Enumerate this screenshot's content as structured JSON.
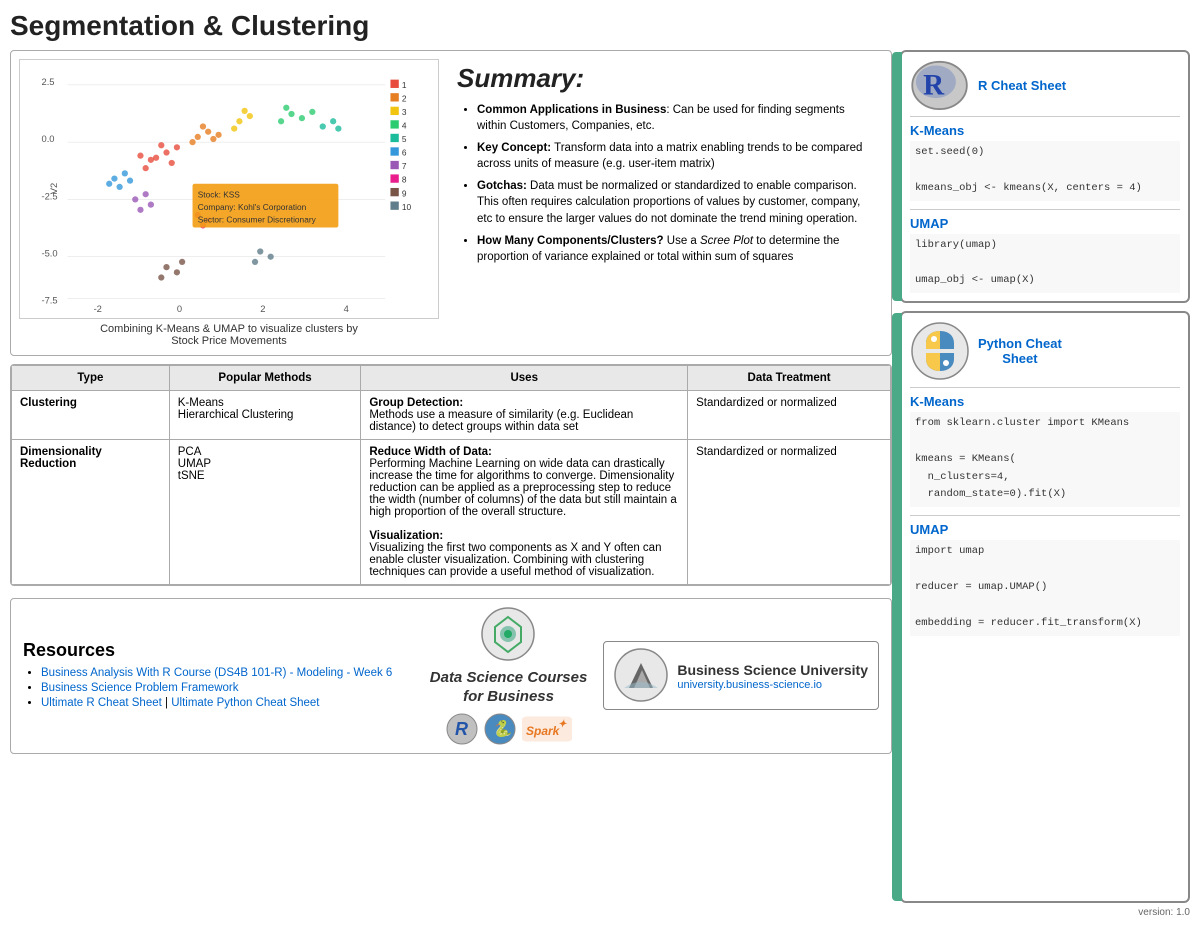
{
  "page": {
    "title": "Segmentation & Clustering",
    "version": "version: 1.0"
  },
  "chart": {
    "caption": "Combining K-Means & UMAP to visualize clusters by\nStock Price Movements",
    "tooltip": {
      "stock": "Stock: KSS",
      "company": "Company: Kohl's Corporation",
      "sector": "Sector: Consumer Discretionary"
    },
    "legend": [
      "1",
      "2",
      "3",
      "4",
      "5",
      "6",
      "7",
      "8",
      "9",
      "10"
    ]
  },
  "summary": {
    "title": "Summary:",
    "bullets": [
      {
        "bold": "Common Applications in Business",
        "text": ": Can be used for finding segments within Customers, Companies, etc."
      },
      {
        "bold": "Key Concept:",
        "text": " Transform data into a matrix enabling trends to be compared across units of measure (e.g. user-item matrix)"
      },
      {
        "bold": "Gotchas:",
        "text": " Data must be normalized or standardized to enable comparison. This often requires calculation proportions of values by customer, company, etc to ensure the larger values do not dominate the trend mining operation."
      },
      {
        "bold": "How Many Components/Clusters?",
        "text": " Use a Scree Plot to determine the proportion of variance explained or total within sum of squares",
        "italic": "Scree Plot"
      }
    ]
  },
  "table": {
    "headers": [
      "Type",
      "Popular Methods",
      "Uses",
      "Data Treatment"
    ],
    "rows": [
      {
        "type": "Clustering",
        "methods": "K-Means\nHierarchical Clustering",
        "uses_title": "Group Detection:",
        "uses_body": "Methods use a measure of similarity (e.g. Euclidean distance) to detect groups within data set",
        "treatment": "Standardized or normalized"
      },
      {
        "type": "Dimensionality Reduction",
        "methods": "PCA\nUMAP\ntSNE",
        "uses_title1": "Reduce Width of Data:",
        "uses_body1": "Performing Machine Learning on wide data can drastically increase the time for algorithms to converge. Dimensionality reduction can be applied as a preprocessing step to reduce the width (number of columns) of the data but still maintain a high proportion of the overall structure.",
        "uses_title2": "Visualization:",
        "uses_body2": "Visualizing the first two components as X and Y often can enable cluster visualization. Combining with clustering techniques can provide a useful method of visualization.",
        "treatment": "Standardized or normalized"
      }
    ]
  },
  "r_cheat": {
    "link_text": "R Cheat Sheet",
    "kmeans_title": "K-Means",
    "kmeans_code": [
      "set.seed(0)",
      "kmeans_obj <- kmeans(X, centers = 4)"
    ],
    "umap_title": "UMAP",
    "umap_code": [
      "library(umap)",
      "umap_obj <- umap(X)"
    ]
  },
  "python_cheat": {
    "link_text": "Python Cheat\nSheet",
    "kmeans_title": "K-Means",
    "kmeans_code": [
      "from sklearn.cluster import KMeans",
      "kmeans = KMeans(",
      "  n_clusters=4,",
      "  random_state=0).fit(X)"
    ],
    "umap_title": "UMAP",
    "umap_code": [
      "import umap",
      "reducer = umap.UMAP()",
      "embedding = reducer.fit_transform(X)"
    ]
  },
  "resources": {
    "title": "Resources",
    "items": [
      {
        "text": "Business Analysis With R Course (DS4B 101-R) - Modeling - Week 6",
        "url": "#"
      },
      {
        "text": "Business Science Problem Framework",
        "url": "#"
      },
      {
        "before": "Ultimate R Cheat Sheet",
        "separator": " | ",
        "after": "Ultimate Python Cheat Sheet",
        "url1": "#",
        "url2": "#"
      }
    ],
    "center_text": "Data Science Courses\nfor Business",
    "bsu_name": "Business Science University",
    "bsu_url": "university.business-science.io"
  }
}
